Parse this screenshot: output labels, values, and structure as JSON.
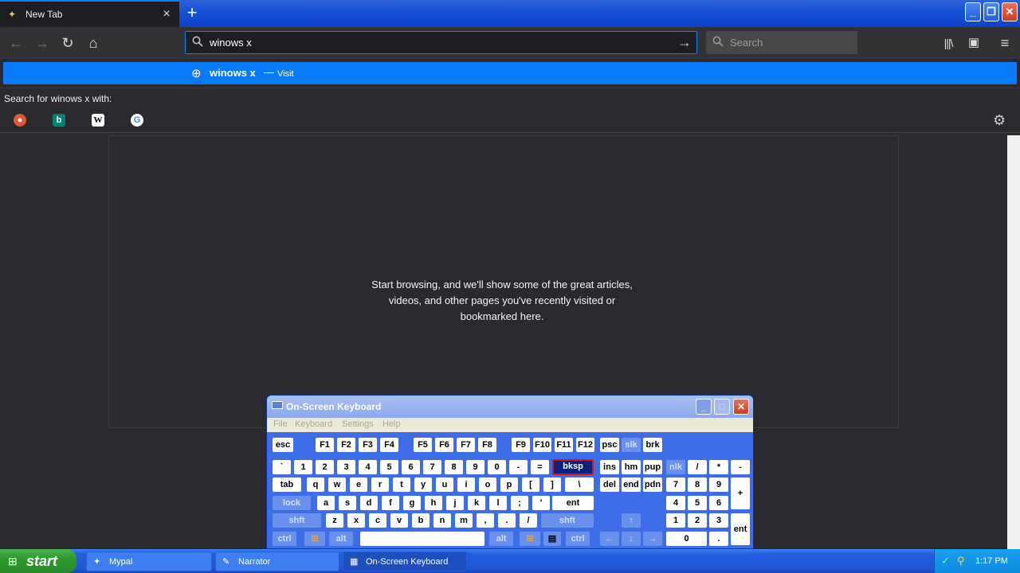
{
  "browser": {
    "tab": {
      "title": "New Tab",
      "close": "×"
    },
    "new_tab": "+",
    "window_controls": {
      "minimize": "_",
      "restore": "❐",
      "close": "✕"
    },
    "nav": {
      "back": "←",
      "forward": "→",
      "reload": "↻",
      "home": "⌂"
    },
    "urlbar": {
      "value": "winows x",
      "search_icon": "search-icon",
      "go": "→"
    },
    "searchbar": {
      "placeholder": "Search",
      "search_icon": "⚲"
    },
    "toolbar_right": {
      "library": "|||\\",
      "sidebar": "▣",
      "menu": "≡"
    },
    "suggestion": {
      "text": "winows x",
      "dash": "—",
      "action": "Visit",
      "globe": "⊕"
    },
    "search_with": {
      "label": "Search for winows x with:"
    },
    "engines": [
      {
        "name": "duckduckgo",
        "glyph": "●",
        "color": "#de5833"
      },
      {
        "name": "bing",
        "glyph": "b",
        "color": "#008373"
      },
      {
        "name": "wikipedia",
        "glyph": "W",
        "color": "#ffffff"
      },
      {
        "name": "google",
        "glyph": "G",
        "color": "#ffffff"
      }
    ],
    "settings": "⚙",
    "empty_hint": [
      "Start browsing, and we'll show some of the great articles,",
      "videos, and other pages you've recently visited or",
      "bookmarked here."
    ]
  },
  "osk": {
    "title": "On-Screen Keyboard",
    "controls": {
      "minimize": "_",
      "maximize": "□",
      "close": "✕"
    },
    "menu": [
      "File",
      "Keyboard",
      "Settings",
      "Help"
    ],
    "keys": {
      "esc": "esc",
      "f1": "F1",
      "f2": "F2",
      "f3": "F3",
      "f4": "F4",
      "f5": "F5",
      "f6": "F6",
      "f7": "F7",
      "f8": "F8",
      "f9": "F9",
      "f10": "F10",
      "f11": "F11",
      "f12": "F12",
      "psc": "psc",
      "slk": "slk",
      "brk": "brk",
      "row1": [
        "`",
        "1",
        "2",
        "3",
        "4",
        "5",
        "6",
        "7",
        "8",
        "9",
        "0",
        "-",
        "="
      ],
      "bksp": "bksp",
      "ins": "ins",
      "hm": "hm",
      "pup": "pup",
      "nlk": "nlk",
      "div": "/",
      "mul": "*",
      "sub": "-",
      "tab": "tab",
      "row2": [
        "q",
        "w",
        "e",
        "r",
        "t",
        "y",
        "u",
        "i",
        "o",
        "p",
        "[",
        "]",
        "\\"
      ],
      "del": "del",
      "end": "end",
      "pdn": "pdn",
      "n7": "7",
      "n8": "8",
      "n9": "9",
      "add": "+",
      "lock": "lock",
      "row3": [
        "a",
        "s",
        "d",
        "f",
        "g",
        "h",
        "j",
        "k",
        "l",
        ";",
        "'"
      ],
      "ent": "ent",
      "n4": "4",
      "n5": "5",
      "n6": "6",
      "shft": "shft",
      "row4": [
        "z",
        "x",
        "c",
        "v",
        "b",
        "n",
        "m",
        ",",
        ".",
        "/"
      ],
      "up": "↑",
      "n1": "1",
      "n2": "2",
      "n3": "3",
      "nent": "ent",
      "ctrl": "ctrl",
      "win": "⊞",
      "alt": "alt",
      "space": "",
      "apps": "▤",
      "left": "←",
      "down": "↓",
      "right": "→",
      "n0": "0",
      "dot": "."
    }
  },
  "taskbar": {
    "start": "start",
    "tasks": [
      {
        "label": "Mypal",
        "icon": "✦"
      },
      {
        "label": "Narrator",
        "icon": "✎"
      },
      {
        "label": "On-Screen Keyboard",
        "icon": "▦"
      }
    ],
    "clock": "1:17 PM"
  }
}
